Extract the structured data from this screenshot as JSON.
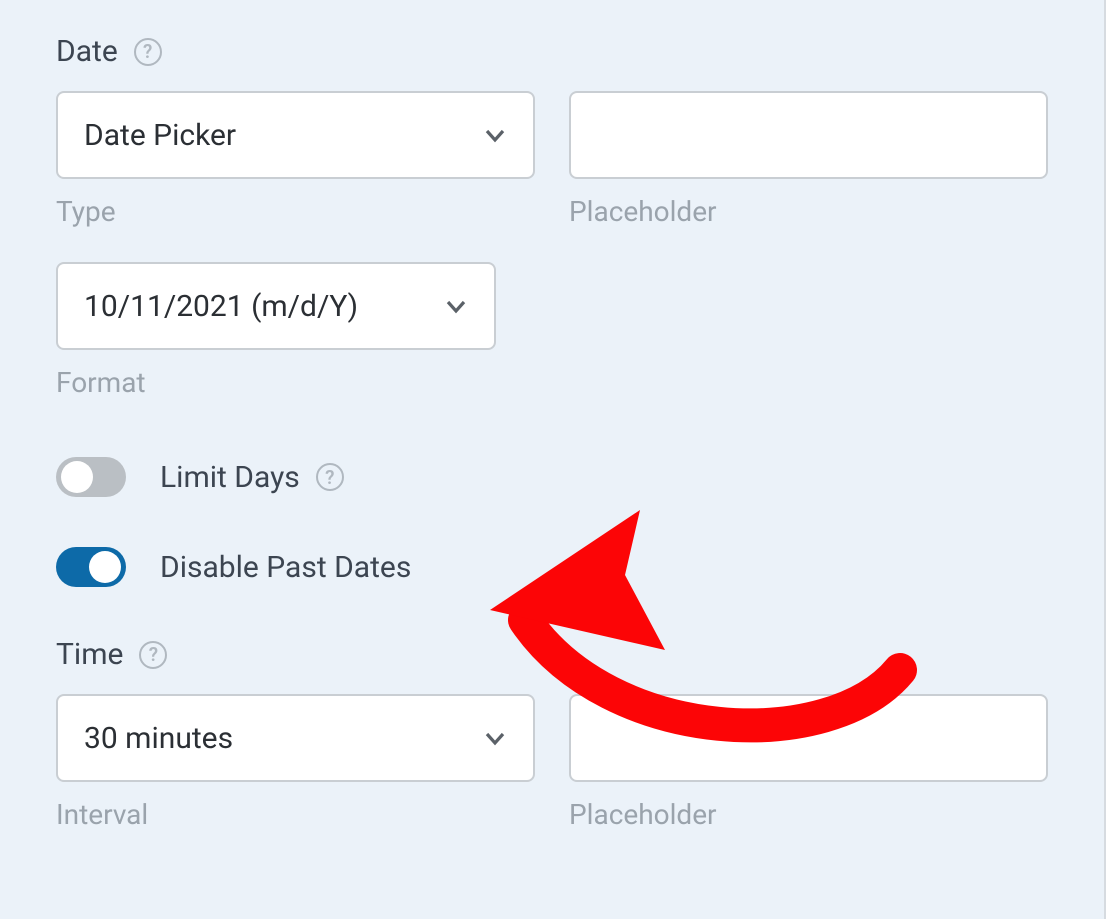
{
  "date": {
    "title": "Date",
    "type_select": "Date Picker",
    "type_label": "Type",
    "placeholder_value": "",
    "placeholder_label": "Placeholder",
    "format_select": "10/11/2021 (m/d/Y)",
    "format_label": "Format"
  },
  "toggles": {
    "limit_days": {
      "label": "Limit Days",
      "on": false
    },
    "disable_past": {
      "label": "Disable Past Dates",
      "on": true
    }
  },
  "time": {
    "title": "Time",
    "interval_select": "30 minutes",
    "interval_label": "Interval",
    "placeholder_value": "",
    "placeholder_label": "Placeholder"
  }
}
